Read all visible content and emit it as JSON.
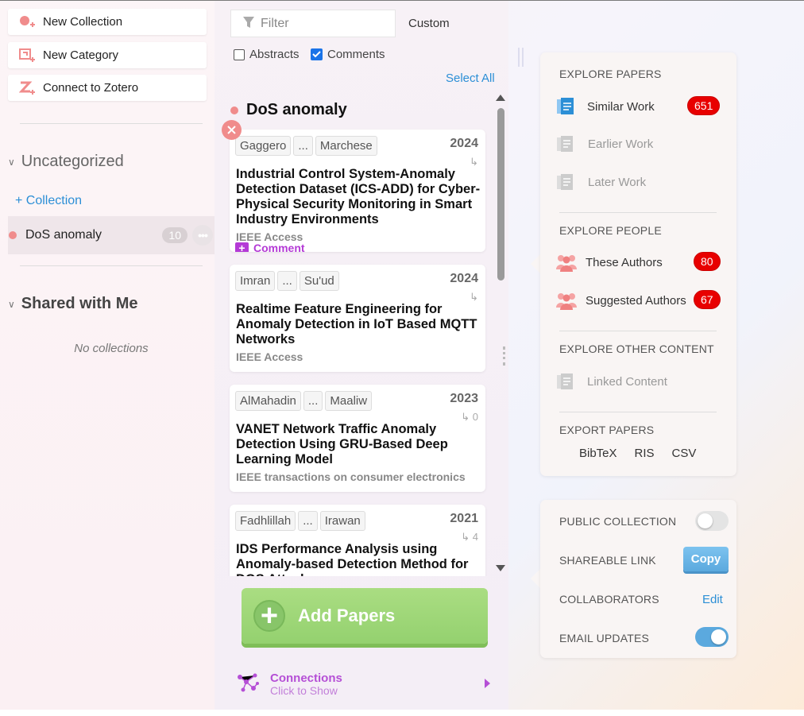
{
  "sidebar": {
    "buttons": [
      {
        "label": "New Collection",
        "icon": "new-collection-icon"
      },
      {
        "label": "New Category",
        "icon": "new-category-icon"
      },
      {
        "label": "Connect to Zotero",
        "icon": "zotero-icon"
      }
    ],
    "uncategorized": {
      "title": "Uncategorized",
      "add_label": "+ Collection"
    },
    "collection": {
      "name": "DoS anomaly",
      "count": "10"
    },
    "shared": {
      "title": "Shared with Me",
      "empty": "No collections"
    }
  },
  "middle": {
    "filter_placeholder": "Filter",
    "custom_label": "Custom",
    "abstracts_label": "Abstracts",
    "comments_label": "Comments",
    "select_all": "Select All",
    "collection_title": "DoS anomaly",
    "papers": [
      {
        "first_author": "Gaggero",
        "ellipsis": "...",
        "last_author": "Marchese",
        "year": "2024",
        "cites": "↳",
        "title": "Industrial Control System-Anomaly Detection Dataset (ICS-ADD) for Cyber-Physical Security Monitoring in Smart Industry Environments",
        "venue": "IEEE Access"
      },
      {
        "first_author": "Imran",
        "ellipsis": "...",
        "last_author": "Su'ud",
        "year": "2024",
        "cites": "↳",
        "title": "Realtime Feature Engineering for Anomaly Detection in IoT Based MQTT Networks",
        "venue": "IEEE Access"
      },
      {
        "first_author": "AlMahadin",
        "ellipsis": "...",
        "last_author": "Maaliw",
        "year": "2023",
        "cites": "↳ 0",
        "title": "VANET Network Traffic Anomaly Detection Using GRU-Based Deep Learning Model",
        "venue": "IEEE transactions on consumer electronics"
      },
      {
        "first_author": "Fadhlillah",
        "ellipsis": "...",
        "last_author": "Irawan",
        "year": "2021",
        "cites": "↳ 4",
        "title": "IDS Performance Analysis using Anomaly-based Detection Method for DOS Attack",
        "venue": ""
      }
    ],
    "comment_label": "Comment",
    "add_papers": "Add Papers",
    "connections": {
      "title": "Connections",
      "subtitle": "Click to Show"
    }
  },
  "explore": {
    "papers_head": "EXPLORE PAPERS",
    "similar": {
      "label": "Similar Work",
      "count": "651"
    },
    "earlier": {
      "label": "Earlier Work"
    },
    "later": {
      "label": "Later Work"
    },
    "people_head": "EXPLORE PEOPLE",
    "these_authors": {
      "label": "These Authors",
      "count": "80"
    },
    "suggested_authors": {
      "label": "Suggested Authors",
      "count": "67"
    },
    "other_head": "EXPLORE OTHER CONTENT",
    "linked": {
      "label": "Linked Content"
    },
    "export_head": "EXPORT PAPERS",
    "export": [
      "BibTeX",
      "RIS",
      "CSV"
    ]
  },
  "settings": {
    "public": {
      "label": "PUBLIC COLLECTION",
      "on": false
    },
    "shareable": {
      "label": "SHAREABLE LINK",
      "button": "Copy"
    },
    "collaborators": {
      "label": "COLLABORATORS",
      "button": "Edit"
    },
    "email": {
      "label": "EMAIL UPDATES",
      "on": true
    }
  },
  "colors": {
    "accent_red": "#e80000",
    "link_blue": "#2c8fd6",
    "green": "#94d16f",
    "purple": "#b54fd6",
    "dot": "#f08c8c"
  }
}
